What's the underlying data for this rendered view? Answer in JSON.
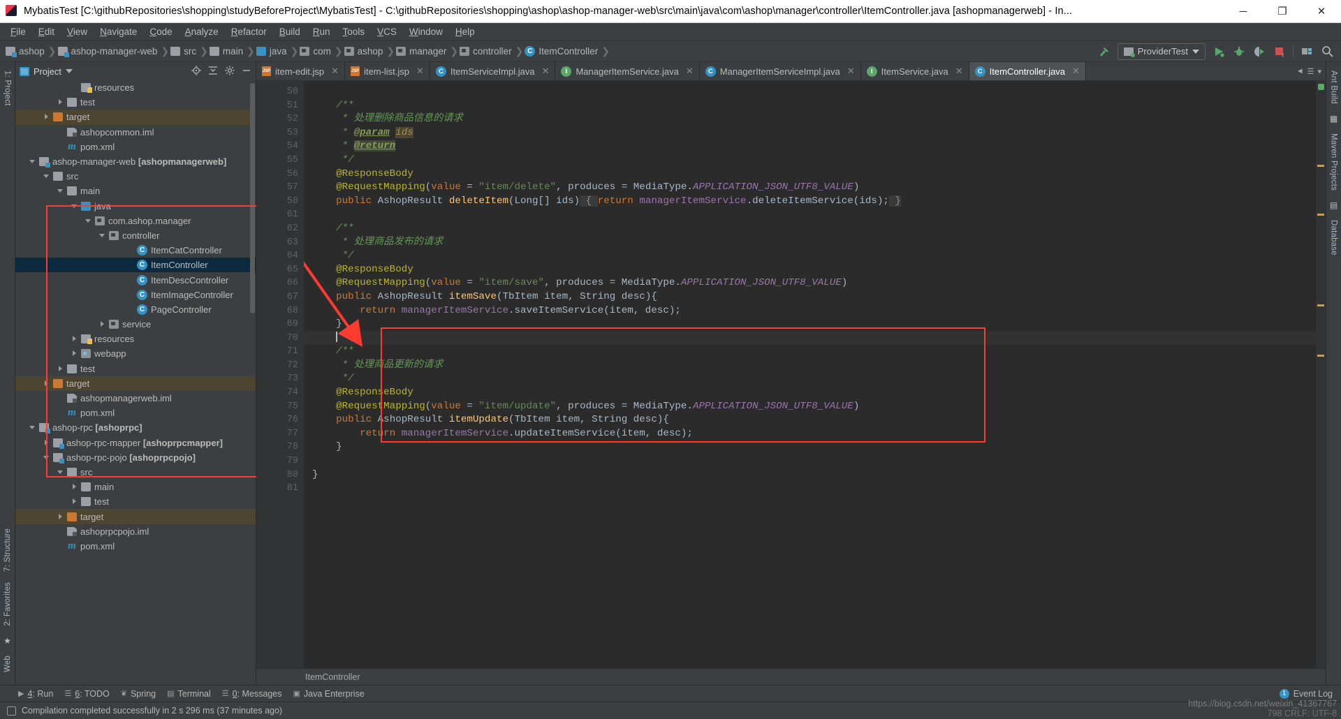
{
  "titlebar": {
    "text": "MybatisTest [C:\\githubRepositories\\shopping\\studyBeforeProject\\MybatisTest] - C:\\githubRepositories\\shopping\\ashop\\ashop-manager-web\\src\\main\\java\\com\\ashop\\manager\\controller\\ItemController.java [ashopmanagerweb] - In...",
    "minimize": "─",
    "maximize": "❐",
    "close": "✕"
  },
  "menubar": [
    "File",
    "Edit",
    "View",
    "Navigate",
    "Code",
    "Analyze",
    "Refactor",
    "Build",
    "Run",
    "Tools",
    "VCS",
    "Window",
    "Help"
  ],
  "navbar": {
    "crumbs": [
      {
        "label": "ashop",
        "icon": "module-icon"
      },
      {
        "label": "ashop-manager-web",
        "icon": "module-icon"
      },
      {
        "label": "src",
        "icon": "folder-icon"
      },
      {
        "label": "main",
        "icon": "folder-icon"
      },
      {
        "label": "java",
        "icon": "source-folder-icon"
      },
      {
        "label": "com",
        "icon": "package-icon"
      },
      {
        "label": "ashop",
        "icon": "package-icon"
      },
      {
        "label": "manager",
        "icon": "package-icon"
      },
      {
        "label": "controller",
        "icon": "package-icon"
      },
      {
        "label": "ItemController",
        "icon": "class-icon"
      }
    ],
    "run_config": "ProviderTest",
    "icons": [
      "build-hammer-icon",
      "run-icon",
      "debug-icon",
      "run-coverage-icon",
      "stop-icon",
      "project-structure-icon",
      "search-everywhere-icon"
    ]
  },
  "project_panel": {
    "title": "Project",
    "header_icons": [
      "locate-icon",
      "collapse-all-icon",
      "settings-icon",
      "hide-icon"
    ],
    "tree": [
      {
        "indent": 4,
        "arrow": "none",
        "icon": "resources-folder-icon",
        "label": "resources",
        "bold_suffix": "",
        "state": "normal"
      },
      {
        "indent": 3,
        "arrow": "right",
        "icon": "folder-icon",
        "label": "test",
        "bold_suffix": "",
        "state": "normal"
      },
      {
        "indent": 2,
        "arrow": "right",
        "icon": "target-folder-icon",
        "label": "target",
        "bold_suffix": "",
        "state": "highlight"
      },
      {
        "indent": 3,
        "arrow": "none",
        "icon": "iml-file-icon",
        "label": "ashopcommon.iml",
        "bold_suffix": "",
        "state": "normal"
      },
      {
        "indent": 3,
        "arrow": "none",
        "icon": "maven-icon",
        "label": "pom.xml",
        "bold_suffix": "",
        "state": "normal"
      },
      {
        "indent": 1,
        "arrow": "down",
        "icon": "module-icon",
        "label": "ashop-manager-web ",
        "bold_suffix": "[ashopmanagerweb]",
        "state": "normal"
      },
      {
        "indent": 2,
        "arrow": "down",
        "icon": "folder-icon",
        "label": "src",
        "bold_suffix": "",
        "state": "normal"
      },
      {
        "indent": 3,
        "arrow": "down",
        "icon": "folder-icon",
        "label": "main",
        "bold_suffix": "",
        "state": "normal"
      },
      {
        "indent": 4,
        "arrow": "down",
        "icon": "source-folder-icon",
        "label": "java",
        "bold_suffix": "",
        "state": "normal"
      },
      {
        "indent": 5,
        "arrow": "down",
        "icon": "package-icon",
        "label": "com.ashop.manager",
        "bold_suffix": "",
        "state": "normal"
      },
      {
        "indent": 6,
        "arrow": "down",
        "icon": "package-icon",
        "label": "controller",
        "bold_suffix": "",
        "state": "normal"
      },
      {
        "indent": 8,
        "arrow": "none",
        "icon": "class-icon",
        "label": "ItemCatController",
        "bold_suffix": "",
        "state": "normal"
      },
      {
        "indent": 8,
        "arrow": "none",
        "icon": "class-icon",
        "label": "ItemController",
        "bold_suffix": "",
        "state": "selected"
      },
      {
        "indent": 8,
        "arrow": "none",
        "icon": "class-icon",
        "label": "ItemDescController",
        "bold_suffix": "",
        "state": "normal"
      },
      {
        "indent": 8,
        "arrow": "none",
        "icon": "class-icon",
        "label": "ItemImageController",
        "bold_suffix": "",
        "state": "normal"
      },
      {
        "indent": 8,
        "arrow": "none",
        "icon": "class-icon",
        "label": "PageController",
        "bold_suffix": "",
        "state": "normal"
      },
      {
        "indent": 6,
        "arrow": "right",
        "icon": "package-icon",
        "label": "service",
        "bold_suffix": "",
        "state": "normal"
      },
      {
        "indent": 4,
        "arrow": "right",
        "icon": "resources-folder-icon",
        "label": "resources",
        "bold_suffix": "",
        "state": "normal"
      },
      {
        "indent": 4,
        "arrow": "right",
        "icon": "webapp-folder-icon",
        "label": "webapp",
        "bold_suffix": "",
        "state": "normal"
      },
      {
        "indent": 3,
        "arrow": "right",
        "icon": "folder-icon",
        "label": "test",
        "bold_suffix": "",
        "state": "normal"
      },
      {
        "indent": 2,
        "arrow": "right",
        "icon": "target-folder-icon",
        "label": "target",
        "bold_suffix": "",
        "state": "highlight"
      },
      {
        "indent": 3,
        "arrow": "none",
        "icon": "iml-file-icon",
        "label": "ashopmanagerweb.iml",
        "bold_suffix": "",
        "state": "normal"
      },
      {
        "indent": 3,
        "arrow": "none",
        "icon": "maven-icon",
        "label": "pom.xml",
        "bold_suffix": "",
        "state": "normal"
      },
      {
        "indent": 1,
        "arrow": "down",
        "icon": "module-icon",
        "label": "ashop-rpc ",
        "bold_suffix": "[ashoprpc]",
        "state": "normal"
      },
      {
        "indent": 2,
        "arrow": "right",
        "icon": "module-icon",
        "label": "ashop-rpc-mapper ",
        "bold_suffix": "[ashoprpcmapper]",
        "state": "normal"
      },
      {
        "indent": 2,
        "arrow": "down",
        "icon": "module-icon",
        "label": "ashop-rpc-pojo ",
        "bold_suffix": "[ashoprpcpojo]",
        "state": "normal"
      },
      {
        "indent": 3,
        "arrow": "down",
        "icon": "folder-icon",
        "label": "src",
        "bold_suffix": "",
        "state": "normal"
      },
      {
        "indent": 4,
        "arrow": "right",
        "icon": "folder-icon",
        "label": "main",
        "bold_suffix": "",
        "state": "normal"
      },
      {
        "indent": 4,
        "arrow": "right",
        "icon": "folder-icon",
        "label": "test",
        "bold_suffix": "",
        "state": "normal"
      },
      {
        "indent": 3,
        "arrow": "right",
        "icon": "target-folder-icon",
        "label": "target",
        "bold_suffix": "",
        "state": "highlight"
      },
      {
        "indent": 3,
        "arrow": "none",
        "icon": "iml-file-icon",
        "label": "ashoprpcpojo.iml",
        "bold_suffix": "",
        "state": "normal"
      },
      {
        "indent": 3,
        "arrow": "none",
        "icon": "maven-icon",
        "label": "pom.xml",
        "bold_suffix": "",
        "state": "normal"
      }
    ]
  },
  "left_rail": {
    "top": "1: Project",
    "bottom": [
      "7: Structure",
      "2: Favorites",
      "Web"
    ]
  },
  "right_rail": {
    "items": [
      "Ant Build",
      "Maven Projects",
      "Database"
    ]
  },
  "editor_tabs": [
    {
      "label": "item-edit.jsp",
      "icon": "jsp-file-icon",
      "active": false
    },
    {
      "label": "item-list.jsp",
      "icon": "jsp-file-icon",
      "active": false
    },
    {
      "label": "ItemServiceImpl.java",
      "icon": "class-icon",
      "active": false
    },
    {
      "label": "ManagerItemService.java",
      "icon": "interface-icon",
      "active": false
    },
    {
      "label": "ManagerItemServiceImpl.java",
      "icon": "class-icon",
      "active": false
    },
    {
      "label": "ItemService.java",
      "icon": "interface-icon",
      "active": false
    },
    {
      "label": "ItemController.java",
      "icon": "class-icon",
      "active": true
    }
  ],
  "code": {
    "first_line": 50,
    "lines": [
      {
        "n": 50,
        "fold": "",
        "html": ""
      },
      {
        "n": 51,
        "fold": "minus",
        "html": "    <span class='cmt'>/**</span>"
      },
      {
        "n": 52,
        "fold": "",
        "html": "     <span class='cmt'>* 处理删除商品信息的请求</span>"
      },
      {
        "n": 53,
        "fold": "",
        "html": "     <span class='cmt'>* </span><span class='cmt-tag'>@param</span><span class='cmt'> </span><span class='cmt-param'>ids</span>"
      },
      {
        "n": 54,
        "fold": "",
        "html": "     <span class='cmt'>* </span><span class='cmt-tag cmt-ret'>@return</span>"
      },
      {
        "n": 55,
        "fold": "up",
        "html": "     <span class='cmt'>*/</span>"
      },
      {
        "n": 56,
        "fold": "minus",
        "html": "    <span class='ann'>@ResponseBody</span>"
      },
      {
        "n": 57,
        "fold": "up",
        "html": "    <span class='ann'>@RequestMapping</span><span class='plain'>(</span><span class='kw'>value</span><span class='plain'> = </span><span class='str'>\"item/delete\"</span><span class='plain'>, produces = MediaType.</span><span class='static'>APPLICATION_JSON_UTF8_VALUE</span><span class='plain'>)</span>"
      },
      {
        "n": 58,
        "fold": "plus",
        "html": "    <span class='kw'>public</span><span class='plain'> AshopResult </span><span class='meth'>deleteItem</span><span class='plain'>(Long[] ids)</span><span class='inline-hint'> { </span><span class='kw'>return</span><span class='plain'> </span><span class='field'>managerItemService</span><span class='plain'>.deleteItemService(ids);</span><span class='inline-hint'> }</span>"
      },
      {
        "n": 61,
        "fold": "",
        "html": ""
      },
      {
        "n": 62,
        "fold": "minus",
        "html": "    <span class='cmt'>/**</span>"
      },
      {
        "n": 63,
        "fold": "",
        "html": "     <span class='cmt'>* 处理商品发布的请求</span>"
      },
      {
        "n": 64,
        "fold": "up",
        "html": "     <span class='cmt'>*/</span>"
      },
      {
        "n": 65,
        "fold": "minus",
        "html": "    <span class='ann'>@ResponseBody</span>"
      },
      {
        "n": 66,
        "fold": "minus",
        "html": "    <span class='ann'>@RequestMapping</span><span class='plain'>(</span><span class='kw'>value</span><span class='plain'> = </span><span class='str'>\"item/save\"</span><span class='plain'>, produces = MediaType.</span><span class='static'>APPLICATION_JSON_UTF8_VALUE</span><span class='plain'>)</span>"
      },
      {
        "n": 67,
        "fold": "up",
        "html": "    <span class='kw'>public</span><span class='plain'> AshopResult </span><span class='meth'>itemSave</span><span class='plain'>(TbItem item, String desc){</span>"
      },
      {
        "n": 68,
        "fold": "",
        "html": "        <span class='kw'>return</span><span class='plain'> </span><span class='field'>managerItemService</span><span class='plain'>.saveItemService(item, desc);</span>"
      },
      {
        "n": 69,
        "fold": "up",
        "html": "    <span class='plain'>}</span>"
      },
      {
        "n": 70,
        "fold": "",
        "html": "    <span class='caret-bar'></span>",
        "caret": true
      },
      {
        "n": 71,
        "fold": "minus",
        "html": "    <span class='cmt'>/**</span>"
      },
      {
        "n": 72,
        "fold": "",
        "html": "     <span class='cmt'>* 处理商品更新的请求</span>"
      },
      {
        "n": 73,
        "fold": "up",
        "html": "     <span class='cmt'>*/</span>"
      },
      {
        "n": 74,
        "fold": "minus",
        "html": "    <span class='ann'>@ResponseBody</span>"
      },
      {
        "n": 75,
        "fold": "minus",
        "html": "    <span class='ann'>@RequestMapping</span><span class='plain'>(</span><span class='kw'>value</span><span class='plain'> = </span><span class='str'>\"item/update\"</span><span class='plain'>, produces = MediaType.</span><span class='static'>APPLICATION_JSON_UTF8_VALUE</span><span class='plain'>)</span>"
      },
      {
        "n": 76,
        "fold": "up",
        "html": "    <span class='kw'>public</span><span class='plain'> AshopResult </span><span class='meth'>itemUpdate</span><span class='plain'>(TbItem item, String desc){</span>"
      },
      {
        "n": 77,
        "fold": "",
        "html": "        <span class='kw'>return</span><span class='plain'> </span><span class='field'>managerItemService</span><span class='plain'>.updateItemService(item, desc);</span>"
      },
      {
        "n": 78,
        "fold": "up",
        "html": "    <span class='plain'>}</span>"
      },
      {
        "n": 79,
        "fold": "",
        "html": ""
      },
      {
        "n": 80,
        "fold": "",
        "html": "<span class='plain'>}</span>"
      },
      {
        "n": 81,
        "fold": "",
        "html": ""
      }
    ]
  },
  "editor_footer": {
    "breadcrumb": "ItemController"
  },
  "bottom_bar": {
    "items": [
      {
        "label": "4: Run",
        "icon": "run-icon",
        "underline": "4"
      },
      {
        "label": "6: TODO",
        "icon": "todo-icon",
        "underline": "6"
      },
      {
        "label": "Spring",
        "icon": "spring-icon",
        "underline": ""
      },
      {
        "label": "Terminal",
        "icon": "terminal-icon",
        "underline": ""
      },
      {
        "label": "0: Messages",
        "icon": "messages-icon",
        "underline": "0"
      },
      {
        "label": "Java Enterprise",
        "icon": "java-ee-icon",
        "underline": ""
      }
    ],
    "event_log": "Event Log",
    "event_count": "1"
  },
  "statusbar": {
    "message": "Compilation completed successfully in 2 s 296 ms (37 minutes ago)",
    "watermark_line1": "https://blog.csdn.net/weixin_41367767",
    "watermark_line2": "798  CRLF:  UTF-8"
  },
  "colors": {
    "accent_blue": "#3592c4",
    "annotation_yellow": "#bbb529",
    "string_green": "#6a8759",
    "comment_green": "#629755",
    "keyword_orange": "#cc7832",
    "method_yellow": "#ffc66d",
    "field_purple": "#9876aa",
    "red_box": "#ff3b30",
    "selection_blue": "#0d293e"
  }
}
